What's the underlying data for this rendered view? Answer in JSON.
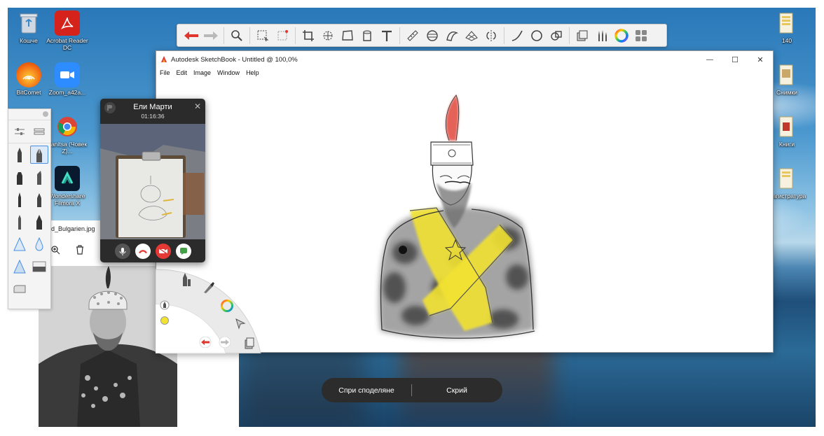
{
  "desktop": {
    "icons_left": [
      {
        "label": "Кошче",
        "icon": "recycle-bin-icon"
      },
      {
        "label": "Acrobat Reader DC",
        "icon": "acrobat-icon"
      },
      {
        "label": "BitComet",
        "icon": "bitcomet-icon"
      },
      {
        "label": "Zoom_a42a...",
        "icon": "zoom-icon"
      },
      {
        "label": "Yanitsa (Човек Z)...",
        "icon": "chrome-icon"
      },
      {
        "label": "Wondershare Filmora X",
        "icon": "filmora-icon"
      }
    ],
    "icons_right": [
      {
        "label": "140",
        "icon": "folder-icon"
      },
      {
        "label": "Снимки",
        "icon": "folder-icon"
      },
      {
        "label": "Книги",
        "icon": "folder-icon"
      },
      {
        "label": "Магистратура",
        "icon": "folder-icon"
      }
    ]
  },
  "sketchbook": {
    "title": "Autodesk SketchBook - Untitled @ 100,0%",
    "menu": [
      "File",
      "Edit",
      "Image",
      "Window",
      "Help"
    ],
    "window_controls": {
      "minimize": "—",
      "maximize": "☐",
      "close": "✕"
    }
  },
  "toolbar": {
    "tools": [
      "undo-icon",
      "redo-icon",
      "zoom-icon",
      "select-icon",
      "lasso-select-icon",
      "crop-icon",
      "transform-icon",
      "distort-icon",
      "bucket-icon",
      "text-icon",
      "ruler-icon",
      "ellipse-guide-icon",
      "french-curve-icon",
      "perspective-icon",
      "symmetry-icon",
      "line-icon",
      "circle-icon",
      "shapes-icon",
      "layers-icon",
      "brush-library-icon",
      "color-wheel-icon",
      "palette-icon"
    ]
  },
  "viewer": {
    "filename": "d_Bulgarien.jpg"
  },
  "call": {
    "name": "Ели Марти",
    "duration": "01:16:36"
  },
  "share_bar": {
    "stop_label": "Спри споделяне",
    "hide_label": "Скрий"
  },
  "colors": {
    "sash_yellow": "#f2e232",
    "flame_red": "#e0463a",
    "call_end_red": "#e53935",
    "share_bar_bg": "#2c2c2c"
  }
}
